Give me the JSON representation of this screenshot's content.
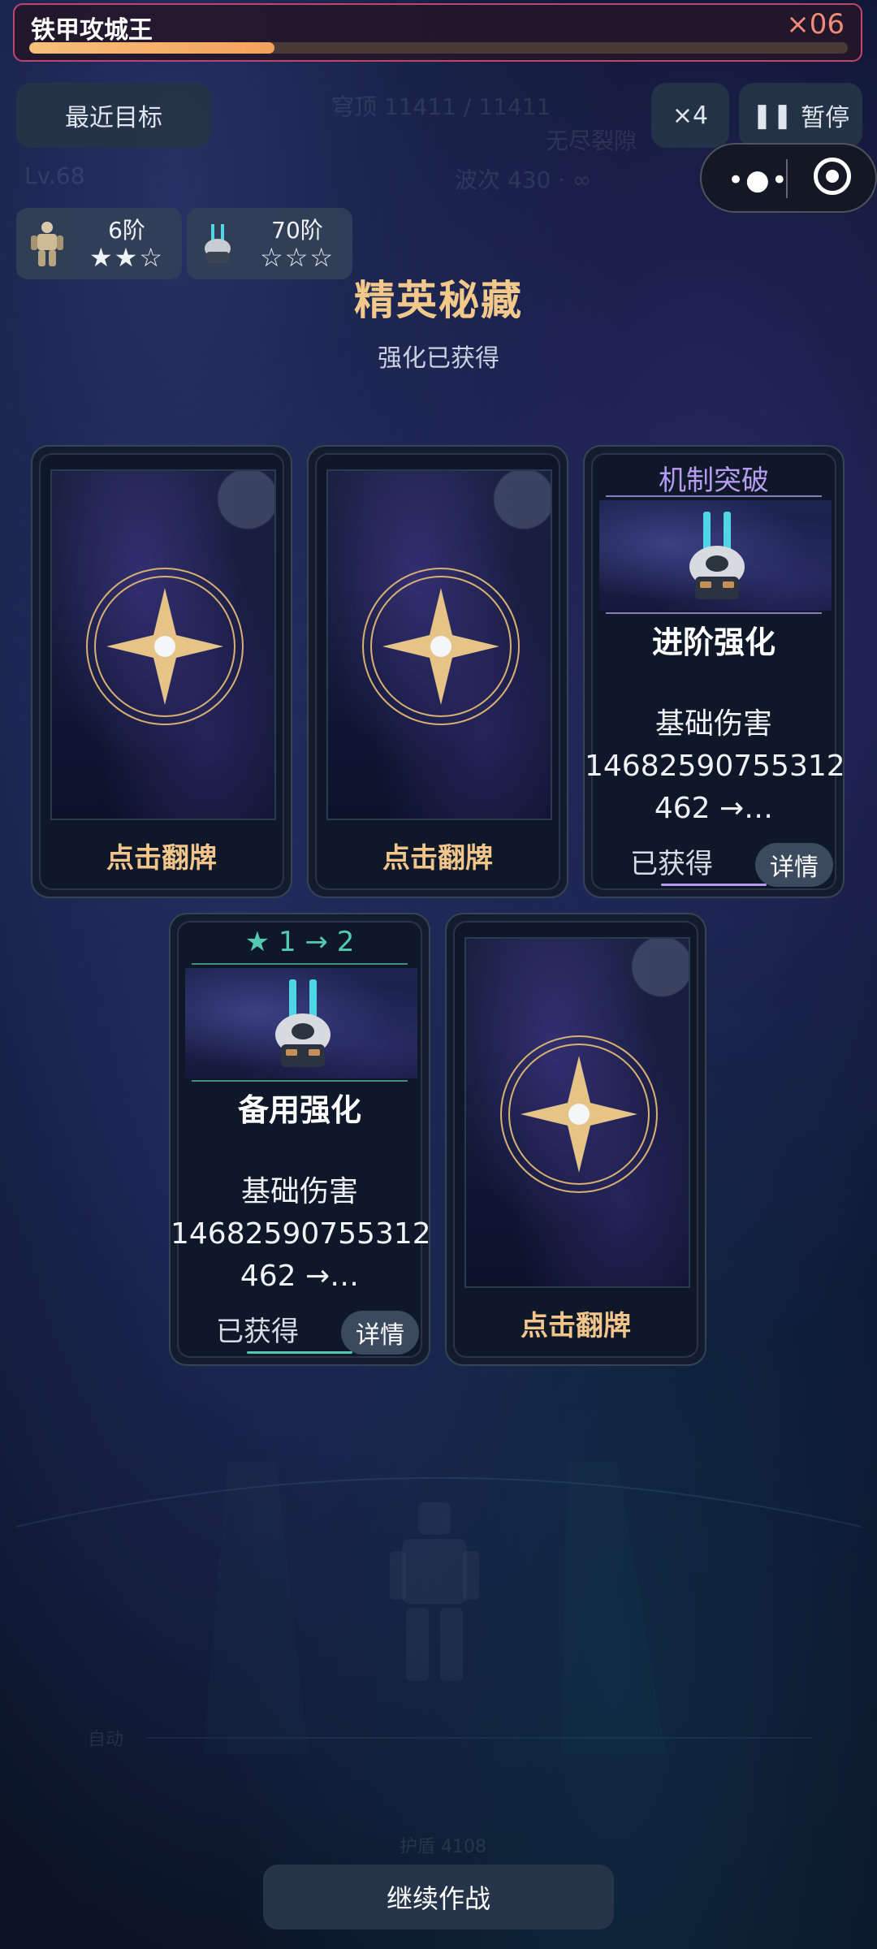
{
  "boss": {
    "name": "铁甲攻城王",
    "count": "×06",
    "hp_fraction": 0.3
  },
  "hud": {
    "recent_target": "最近目标",
    "speed": "×4",
    "pause_icon": "pause-icon",
    "pause": "暂停",
    "dome": "穹顶 11411 / 11411",
    "endless": "无尽裂隙",
    "wave": "波次 430 · ∞",
    "level": "Lv.68",
    "auto": "自动",
    "shield": "护盾 4108"
  },
  "tiers": [
    {
      "icon": "mech-warrior-icon",
      "label": "6阶",
      "stars": "★★☆"
    },
    {
      "icon": "turret-icon",
      "label": "70阶",
      "stars": "☆☆☆"
    }
  ],
  "reward": {
    "title": "精英秘藏",
    "subtitle": "强化已获得"
  },
  "cards": {
    "flip_label": "点击翻牌",
    "c3": {
      "header": "机制突破",
      "name": "进阶强化",
      "desc1": "基础伤害",
      "desc2": "14682590755312",
      "desc3": "462 →…",
      "status": "已获得",
      "detail": "详情",
      "accent": "#b59cf0"
    },
    "c4": {
      "header": "★ 1 → 2",
      "name": "备用强化",
      "desc1": "基础伤害",
      "desc2": "14682590755312",
      "desc3": "462 →…",
      "status": "已获得",
      "detail": "详情",
      "accent": "#52c9b0"
    }
  },
  "continue": "继续作战",
  "colors": {
    "title": "#f2c98a",
    "flip": "#f1c58c",
    "boss_border": "#c0456e",
    "hp_fill": "#f3a15a"
  }
}
